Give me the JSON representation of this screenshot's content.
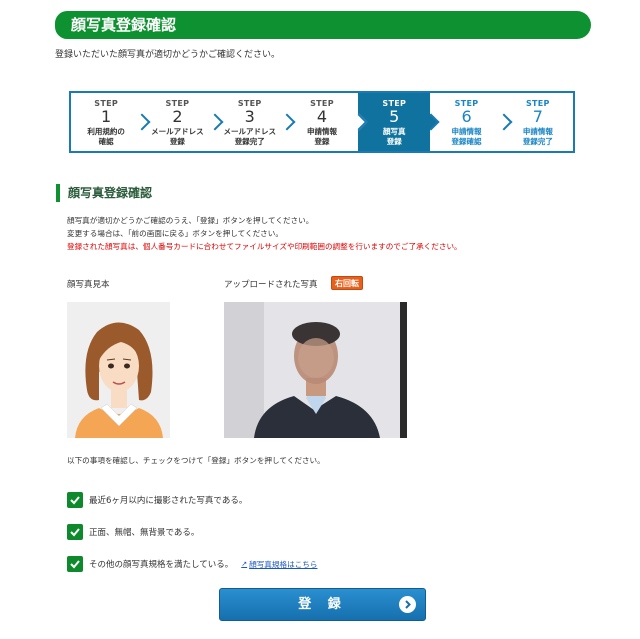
{
  "header": {
    "title": "顔写真登録確認"
  },
  "intro": "登録いただいた顔写真が適切かどうかご確認ください。",
  "steps": [
    {
      "label": "STEP",
      "num": "1",
      "name": "利用規約の\n確認",
      "state": "done"
    },
    {
      "label": "STEP",
      "num": "2",
      "name": "メールアドレス\n登録",
      "state": "done"
    },
    {
      "label": "STEP",
      "num": "3",
      "name": "メールアドレス\n登録完了",
      "state": "done"
    },
    {
      "label": "STEP",
      "num": "4",
      "name": "申請情報\n登録",
      "state": "done"
    },
    {
      "label": "STEP",
      "num": "5",
      "name": "顔写真\n登録",
      "state": "current"
    },
    {
      "label": "STEP",
      "num": "6",
      "name": "申請情報\n登録確認",
      "state": "future"
    },
    {
      "label": "STEP",
      "num": "7",
      "name": "申請情報\n登録完了",
      "state": "future"
    }
  ],
  "section": {
    "title": "顔写真登録確認"
  },
  "description": {
    "line1": "顔写真が適切かどうかご確認のうえ、「登録」ボタンを押してください。",
    "line2": "変更する場合は、「前の画面に戻る」ボタンを押してください。",
    "warning": "登録された顔写真は、個人番号カードに合わせてファイルサイズや印刷範囲の調整を行いますのでご了承ください。"
  },
  "photos": {
    "sample_label": "顔写真見本",
    "upload_label": "アップロードされた写真",
    "rotate_label": "右回転"
  },
  "confirm_note": "以下の事項を確認し、チェックをつけて「登録」ボタンを押してください。",
  "checks": [
    {
      "text": "最近6ヶ月以内に撮影された写真である。",
      "checked": true
    },
    {
      "text": "正面、無帽、無背景である。",
      "checked": true
    },
    {
      "text": "その他の顔写真規格を満たしている。",
      "checked": true,
      "link": "顔写真規格はこちら"
    }
  ],
  "register": {
    "label": "登 録"
  },
  "colors": {
    "brand_green": "#0e9130",
    "step_blue": "#1a7ab5",
    "current_step": "#10729e",
    "warning_red": "#e00000",
    "rotate_orange": "#e8601c"
  }
}
